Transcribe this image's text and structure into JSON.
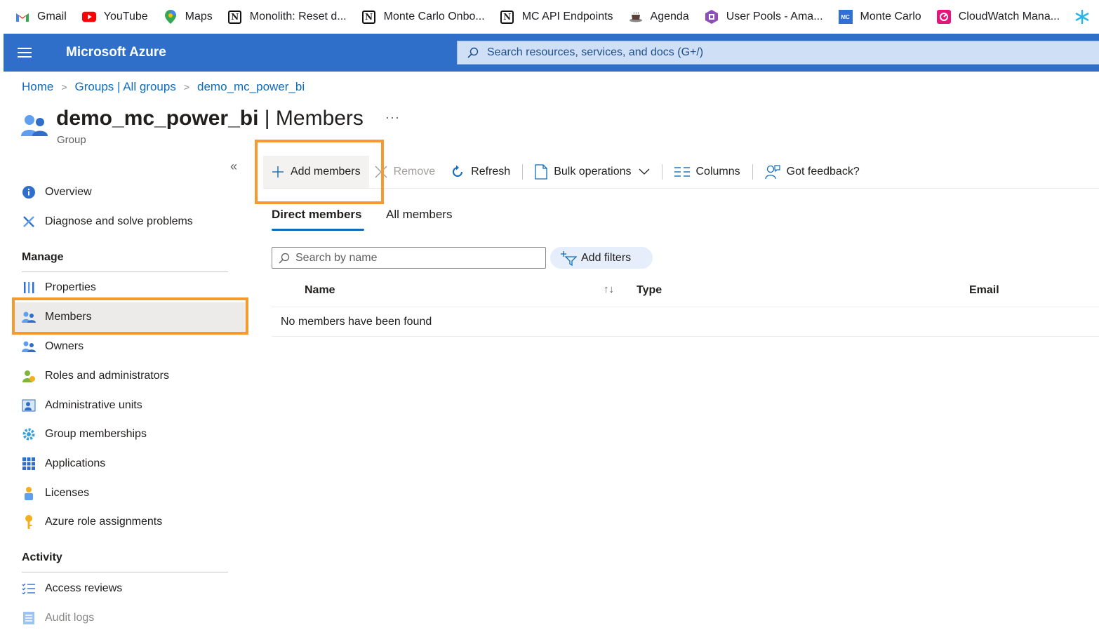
{
  "bookmarks": [
    {
      "label": "Gmail",
      "icon": "gmail-icon"
    },
    {
      "label": "YouTube",
      "icon": "youtube-icon"
    },
    {
      "label": "Maps",
      "icon": "maps-icon"
    },
    {
      "label": "Monolith: Reset d...",
      "icon": "notion-icon"
    },
    {
      "label": "Monte Carlo Onbo...",
      "icon": "notion-icon"
    },
    {
      "label": "MC API Endpoints",
      "icon": "notion-icon"
    },
    {
      "label": "Agenda",
      "icon": "coffee-icon"
    },
    {
      "label": "User Pools - Ama...",
      "icon": "cognito-icon"
    },
    {
      "label": "Monte Carlo",
      "icon": "mc-icon"
    },
    {
      "label": "CloudWatch Mana...",
      "icon": "cloudwatch-icon"
    }
  ],
  "topbar": {
    "brand": "Microsoft Azure",
    "search_placeholder": "Search resources, services, and docs (G+/)"
  },
  "breadcrumb": [
    "Home",
    "Groups | All groups",
    "demo_mc_power_bi"
  ],
  "header": {
    "title_bold": "demo_mc_power_bi",
    "title_rest": " | Members",
    "more": "···",
    "subtitle": "Group"
  },
  "nav": {
    "collapse": "«",
    "top_items": [
      "Overview",
      "Diagnose and solve problems"
    ],
    "manage_label": "Manage",
    "manage_items": [
      "Properties",
      "Members",
      "Owners",
      "Roles and administrators",
      "Administrative units",
      "Group memberships",
      "Applications",
      "Licenses",
      "Azure role assignments"
    ],
    "activity_label": "Activity",
    "activity_items": [
      "Access reviews",
      "Audit logs"
    ]
  },
  "commands": {
    "add_members": "Add members",
    "remove": "Remove",
    "refresh": "Refresh",
    "bulk": "Bulk operations",
    "columns": "Columns",
    "feedback": "Got feedback?"
  },
  "tabs": {
    "direct": "Direct members",
    "all": "All members"
  },
  "filters": {
    "search_placeholder": "Search by name",
    "add_filters": "Add filters"
  },
  "table": {
    "columns": [
      "Name",
      "Type",
      "Email"
    ],
    "sort_indicator": "↑↓",
    "empty_message": "No members have been found"
  },
  "colors": {
    "azure_blue": "#2f6fc9",
    "highlight": "#f59a2f",
    "link": "#0f6cbd"
  }
}
